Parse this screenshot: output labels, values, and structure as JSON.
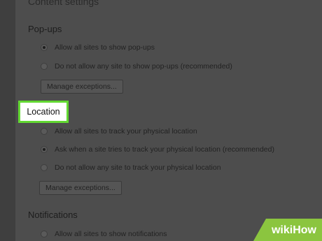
{
  "header": {
    "title": "Content settings"
  },
  "popups": {
    "title": "Pop-ups",
    "options": [
      {
        "label": "Allow all sites to show pop-ups",
        "checked": true
      },
      {
        "label": "Do not allow any site to show pop-ups (recommended)",
        "checked": false
      }
    ],
    "manage_label": "Manage exceptions..."
  },
  "location": {
    "title": "Location",
    "options": [
      {
        "label": "Allow all sites to track your physical location",
        "checked": false
      },
      {
        "label": "Ask when a site tries to track your physical location (recommended)",
        "checked": true
      },
      {
        "label": "Do not allow any site to track your physical location",
        "checked": false
      }
    ],
    "manage_label": "Manage exceptions..."
  },
  "notifications": {
    "title": "Notifications",
    "options": [
      {
        "label": "Allow all sites to show notifications",
        "checked": false
      }
    ]
  },
  "watermark": {
    "wiki": "wiki",
    "how": "How"
  },
  "colors": {
    "highlight_border": "#62d832",
    "watermark_green": "#8bc53f"
  }
}
